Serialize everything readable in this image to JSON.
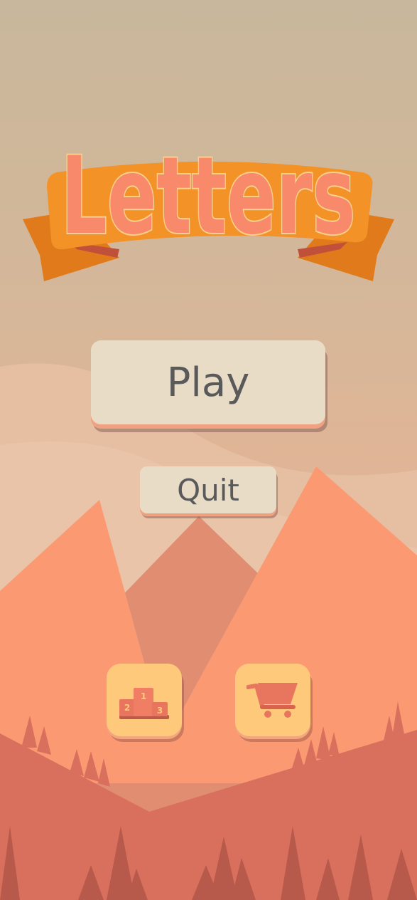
{
  "game": {
    "title": "Letters"
  },
  "menu": {
    "play_label": "Play",
    "quit_label": "Quit"
  },
  "icons": {
    "leaderboard": "podium-icon",
    "shop": "shopping-cart-icon"
  },
  "colors": {
    "title_fill": "#f88a6b",
    "title_outline": "#f9d08e",
    "ribbon": "#f39226",
    "ribbon_dark": "#e07a1a",
    "button_face": "#e9dcc6",
    "button_text": "#5a5a5a",
    "icon_button_face": "#ffc97b",
    "icon_color": "#e8765f"
  }
}
